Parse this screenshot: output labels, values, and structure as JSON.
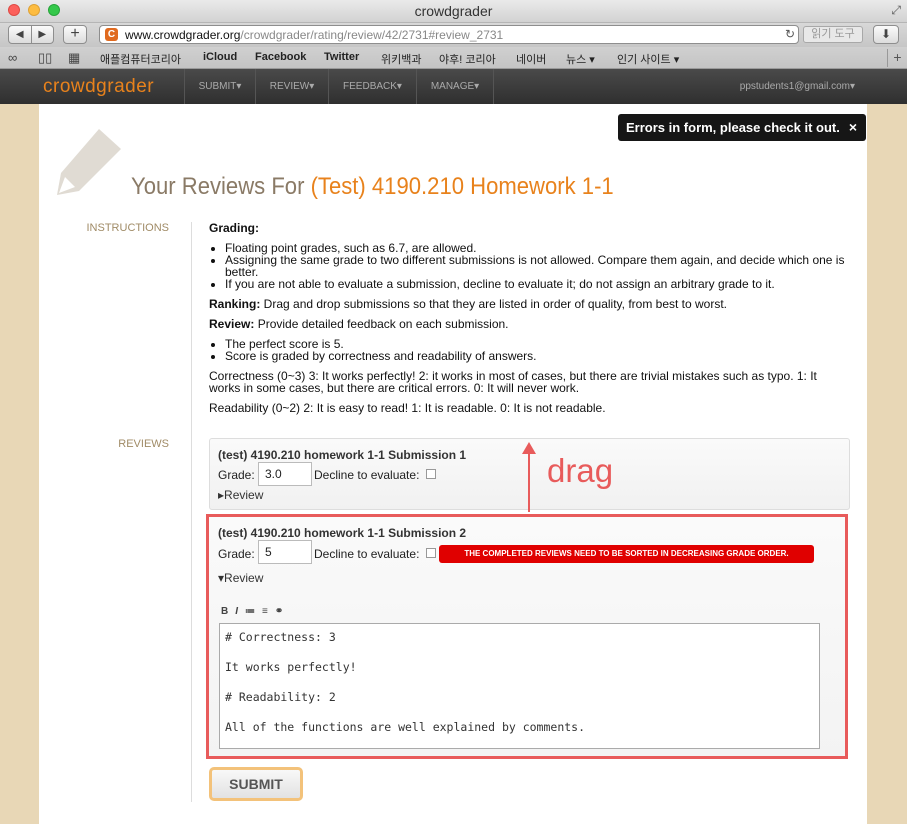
{
  "window": {
    "title": "crowdgrader"
  },
  "toolbar": {
    "back_icon": "back-arrow-icon",
    "forward_icon": "forward-arrow-icon",
    "new_tab_label": "+",
    "url_host": "www.crowdgrader.org",
    "url_path": "/crowdgrader/rating/review/42/2731#review_2731",
    "reader_label": "읽기 도구"
  },
  "bookmarks": [
    "애플컴퓨터코리아",
    "iCloud",
    "Facebook",
    "Twitter",
    "위키백과",
    "야후! 코리아",
    "네이버",
    "뉴스 ▾",
    "인기 사이트 ▾"
  ],
  "sitenav": {
    "logo": "crowdgrader",
    "items": [
      "SUBMIT▾",
      "REVIEW▾",
      "FEEDBACK▾",
      "MANAGE▾"
    ],
    "user": "ppstudents1@gmail.com▾"
  },
  "alert": {
    "text": "Errors in form, please check it out.",
    "close": "×"
  },
  "heading": {
    "prefix": "Your Reviews For ",
    "highlight": "(Test) 4190.210 Homework 1-1"
  },
  "instructions": {
    "label": "INSTRUCTIONS",
    "grading_title": "Grading:",
    "grading_items": [
      "Floating point grades, such as 6.7, are allowed.",
      "Assigning the same grade to two different submissions is not allowed. Compare them again, and decide which one is better.",
      "If you are not able to evaluate a submission, decline to evaluate it; do not assign an arbitrary grade to it."
    ],
    "ranking_title": "Ranking:",
    "ranking_text": " Drag and drop submissions so that they are listed in order of quality, from best to worst.",
    "review_title": "Review:",
    "review_text": " Provide detailed feedback on each submission.",
    "review_items": [
      "The perfect score is 5.",
      "Score is graded by correctness and readability of answers."
    ],
    "correctness": "Correctness (0~3) 3: It works perfectly! 2: it works in most of cases, but there are trivial mistakes such as typo. 1: It works in some cases, but there are critical errors. 0: It will never work.",
    "readability": "Readability (0~2) 2: It is easy to read! 1: It is readable. 0: It is not readable."
  },
  "reviews": {
    "label": "REVIEWS",
    "submissions": [
      {
        "title": "(test) 4190.210 homework 1-1 Submission 1",
        "grade_label": "Grade:",
        "grade": "3.0",
        "decline_label": "Decline to evaluate:",
        "review_toggle": "▸Review"
      },
      {
        "title": "(test) 4190.210 homework 1-1 Submission 2",
        "grade_label": "Grade:",
        "grade": "5",
        "decline_label": "Decline to evaluate:",
        "review_toggle": "▾Review",
        "error": "THE COMPLETED REVIEWS NEED TO BE SORTED IN DECREASING GRADE ORDER.",
        "editor_tools": [
          "B",
          "I",
          "≔",
          "≡",
          "⚭"
        ],
        "review_lines": [
          "# Correctness: 3",
          "It works perfectly!",
          "# Readability: 2",
          "All of the functions are well explained by comments."
        ]
      }
    ]
  },
  "annotation": {
    "text": "drag",
    "color": "#e85b5b"
  },
  "submit_label": "SUBMIT"
}
